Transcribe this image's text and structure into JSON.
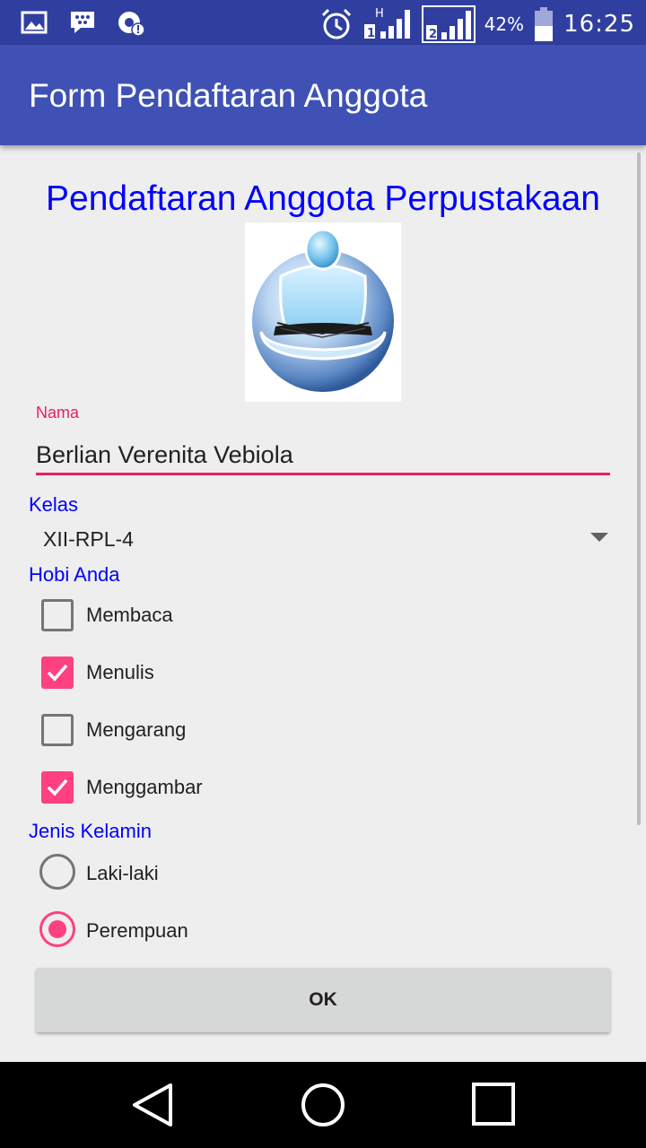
{
  "status_bar": {
    "battery_percent": "42%",
    "time": "16:25",
    "signal_1_label": "H",
    "sim_1": "1",
    "sim_2": "2",
    "icons": [
      "image-icon",
      "bbm-icon",
      "alert-icon",
      "alarm-icon",
      "signal-icon",
      "battery-icon"
    ]
  },
  "app_bar": {
    "title": "Form Pendaftaran Anggota",
    "color": "#3f51b5"
  },
  "form": {
    "heading": "Pendaftaran Anggota Perpustakaan",
    "nama_label": "Nama",
    "nama_value": "Berlian Verenita Vebiola",
    "kelas_label": "Kelas",
    "kelas_value": "XII-RPL-4",
    "hobi_label": "Hobi Anda",
    "hobi": [
      {
        "label": "Membaca",
        "checked": false
      },
      {
        "label": "Menulis",
        "checked": true
      },
      {
        "label": "Mengarang",
        "checked": false
      },
      {
        "label": "Menggambar",
        "checked": true
      }
    ],
    "jenis_kelamin_label": "Jenis Kelamin",
    "jenis_kelamin": [
      {
        "label": "Laki-laki",
        "selected": false
      },
      {
        "label": "Perempuan",
        "selected": true
      }
    ],
    "ok_label": "OK",
    "accent_color": "#ff4081",
    "label_color": "#0000ff"
  },
  "nav_bar": {
    "icons": [
      "back-icon",
      "home-icon",
      "recents-icon"
    ]
  }
}
